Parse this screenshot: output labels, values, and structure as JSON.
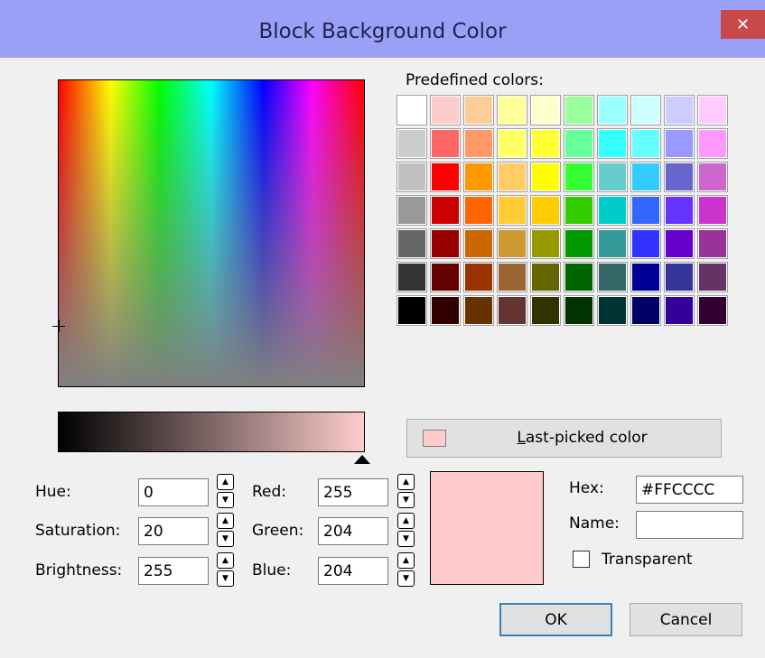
{
  "window": {
    "title": "Block Background Color",
    "close_glyph": "✕"
  },
  "predefined": {
    "label": "Predefined colors:",
    "columns": 10,
    "colors": [
      "#ffffff",
      "#ffcccc",
      "#ffcc99",
      "#ffff99",
      "#ffffcc",
      "#99ff99",
      "#99ffff",
      "#ccffff",
      "#ccccff",
      "#ffccff",
      "#cccccc",
      "#ff6666",
      "#ff9966",
      "#ffff66",
      "#ffff33",
      "#66ff99",
      "#33ffff",
      "#66ffff",
      "#9999ff",
      "#ff99ff",
      "#c0c0c0",
      "#ff0000",
      "#ff9900",
      "#ffcc66",
      "#ffff00",
      "#33ff33",
      "#66cccc",
      "#33ccff",
      "#6666cc",
      "#cc66cc",
      "#999999",
      "#cc0000",
      "#ff6600",
      "#ffcc33",
      "#ffcc00",
      "#33cc00",
      "#00cccc",
      "#3366ff",
      "#6633ff",
      "#cc33cc",
      "#666666",
      "#990000",
      "#cc6600",
      "#cc9933",
      "#999900",
      "#009900",
      "#339999",
      "#3333ff",
      "#6600cc",
      "#993399",
      "#333333",
      "#660000",
      "#993300",
      "#996633",
      "#666600",
      "#006600",
      "#336666",
      "#000099",
      "#333399",
      "#663366",
      "#000000",
      "#330000",
      "#663300",
      "#663333",
      "#333300",
      "#003300",
      "#003333",
      "#000066",
      "#330099",
      "#330033"
    ]
  },
  "last_picked": {
    "label": "Last-picked color",
    "color": "#ffcccc"
  },
  "hsb": {
    "hue_label": "Hue:",
    "hue": "0",
    "saturation_label": "Saturation:",
    "saturation": "20",
    "brightness_label": "Brightness:",
    "brightness": "255"
  },
  "rgb": {
    "red_label": "Red:",
    "red": "255",
    "green_label": "Green:",
    "green": "204",
    "blue_label": "Blue:",
    "blue": "204"
  },
  "hex": {
    "label": "Hex:",
    "value": "#FFCCCC"
  },
  "name": {
    "label": "Name:",
    "value": ""
  },
  "transparent": {
    "label": "Transparent",
    "checked": false
  },
  "preview_color": "#ffcccc",
  "buttons": {
    "ok": "OK",
    "cancel": "Cancel"
  },
  "spinner_glyphs": {
    "up": "▲",
    "down": "▼"
  }
}
